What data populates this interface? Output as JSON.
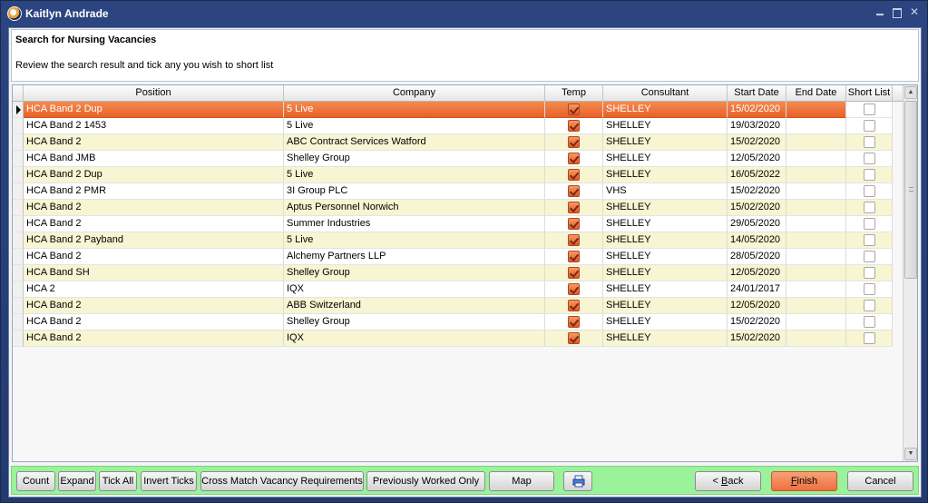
{
  "window": {
    "title": "Kaitlyn Andrade"
  },
  "header": {
    "title": "Search for Nursing Vacancies",
    "subtitle": "Review the search result and tick any you wish to short list"
  },
  "grid": {
    "columns": [
      "Position",
      "Company",
      "Temp",
      "Consultant",
      "Start Date",
      "End Date",
      "Short List"
    ],
    "rows": [
      {
        "position": "HCA Band 2 Dup",
        "company": "5 Live",
        "temp": true,
        "consultant": "SHELLEY",
        "start": "15/02/2020",
        "end": "",
        "short": false
      },
      {
        "position": "HCA Band 2 1453",
        "company": "5 Live",
        "temp": true,
        "consultant": "SHELLEY",
        "start": "19/03/2020",
        "end": "",
        "short": false
      },
      {
        "position": "HCA Band 2",
        "company": "ABC Contract Services Watford",
        "temp": true,
        "consultant": "SHELLEY",
        "start": "15/02/2020",
        "end": "",
        "short": false
      },
      {
        "position": "HCA Band JMB",
        "company": "Shelley Group",
        "temp": true,
        "consultant": "SHELLEY",
        "start": "12/05/2020",
        "end": "",
        "short": false
      },
      {
        "position": "HCA Band 2 Dup",
        "company": "5 Live",
        "temp": true,
        "consultant": "SHELLEY",
        "start": "16/05/2022",
        "end": "",
        "short": false
      },
      {
        "position": "HCA Band 2 PMR",
        "company": "3I Group PLC",
        "temp": true,
        "consultant": "VHS",
        "start": "15/02/2020",
        "end": "",
        "short": false
      },
      {
        "position": "HCA Band 2",
        "company": "Aptus Personnel Norwich",
        "temp": true,
        "consultant": "SHELLEY",
        "start": "15/02/2020",
        "end": "",
        "short": false
      },
      {
        "position": "HCA Band 2",
        "company": "Summer Industries",
        "temp": true,
        "consultant": "SHELLEY",
        "start": "29/05/2020",
        "end": "",
        "short": false
      },
      {
        "position": "HCA Band 2 Payband",
        "company": "5 Live",
        "temp": true,
        "consultant": "SHELLEY",
        "start": "14/05/2020",
        "end": "",
        "short": false
      },
      {
        "position": "HCA Band 2",
        "company": "Alchemy Partners LLP",
        "temp": true,
        "consultant": "SHELLEY",
        "start": "28/05/2020",
        "end": "",
        "short": false
      },
      {
        "position": "HCA Band SH",
        "company": "Shelley Group",
        "temp": true,
        "consultant": "SHELLEY",
        "start": "12/05/2020",
        "end": "",
        "short": false
      },
      {
        "position": "HCA 2",
        "company": "IQX",
        "temp": true,
        "consultant": "SHELLEY",
        "start": "24/01/2017",
        "end": "",
        "short": false
      },
      {
        "position": "HCA Band 2",
        "company": "ABB Switzerland",
        "temp": true,
        "consultant": "SHELLEY",
        "start": "12/05/2020",
        "end": "",
        "short": false
      },
      {
        "position": "HCA Band 2",
        "company": "Shelley Group",
        "temp": true,
        "consultant": "SHELLEY",
        "start": "15/02/2020",
        "end": "",
        "short": false
      },
      {
        "position": "HCA Band 2",
        "company": "IQX",
        "temp": true,
        "consultant": "SHELLEY",
        "start": "15/02/2020",
        "end": "",
        "short": false
      }
    ],
    "selected_row": 0
  },
  "footer": {
    "count": "Count",
    "expand": "Expand",
    "tick_all": "Tick All",
    "invert_ticks": "Invert Ticks",
    "cross_match": "Cross Match Vacancy Requirements",
    "previously_worked": "Previously Worked Only",
    "map": "Map",
    "back_prefix": "< ",
    "back_key": "B",
    "back_rest": "ack",
    "finish_key": "F",
    "finish_rest": "inish",
    "cancel": "Cancel"
  },
  "colors": {
    "selected_row": "#e8622a",
    "alt_row": "#f7f5d2",
    "footer_bg": "#9af29a",
    "finish_button": "#ef7040"
  }
}
